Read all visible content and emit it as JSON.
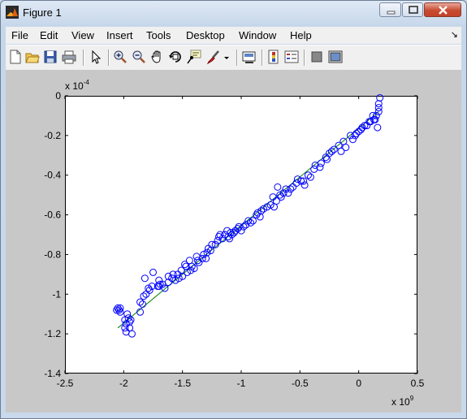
{
  "window": {
    "title": "Figure 1",
    "controls": [
      "minimize-icon",
      "maximize-icon",
      "close-icon"
    ]
  },
  "menu": [
    "File",
    "Edit",
    "View",
    "Insert",
    "Tools",
    "Desktop",
    "Window",
    "Help"
  ],
  "toolbar": [
    "new-figure-icon",
    "open-file-icon",
    "save-icon",
    "print-icon",
    "edit-plot-icon",
    "zoom-in-icon",
    "zoom-out-icon",
    "pan-icon",
    "rotate-3d-icon",
    "data-cursor-icon",
    "brush-icon",
    "brush-dropdown-icon",
    "link-plot-icon",
    "insert-colorbar-icon",
    "insert-legend-icon",
    "hide-plot-tools-icon",
    "show-plot-tools-icon"
  ],
  "chart_data": {
    "type": "scatter",
    "title": "",
    "xlabel": "",
    "ylabel": "",
    "x_exponent_label": "x 10",
    "x_exponent_power": "9",
    "y_exponent_label": "x 10",
    "y_exponent_power": "-4",
    "xlim": [
      -2.5,
      0.5
    ],
    "ylim": [
      -1.4,
      0
    ],
    "xticks": [
      "-2.5",
      "-2",
      "-1.5",
      "-1",
      "-0.5",
      "0",
      "0.5"
    ],
    "yticks": [
      "-1.4",
      "-1.2",
      "-1",
      "-0.8",
      "-0.6",
      "-0.4",
      "-0.2",
      "0"
    ],
    "grid": false,
    "marker": "circle",
    "colors": {
      "marker": "#0000ff",
      "fit_line": "#008000"
    },
    "fit_line": {
      "x": [
        -2.05,
        0.17
      ],
      "y": [
        -1.17,
        -0.08
      ]
    },
    "points": [
      [
        -2.05,
        -1.07
      ],
      [
        -2.06,
        -1.08
      ],
      [
        -2.04,
        -1.08
      ],
      [
        -2.03,
        -1.09
      ],
      [
        -1.99,
        -1.13
      ],
      [
        -1.98,
        -1.15
      ],
      [
        -1.99,
        -1.17
      ],
      [
        -1.98,
        -1.19
      ],
      [
        -1.96,
        -1.12
      ],
      [
        -1.95,
        -1.14
      ],
      [
        -1.95,
        -1.17
      ],
      [
        -1.93,
        -1.2
      ],
      [
        -1.86,
        -1.09
      ],
      [
        -1.84,
        -1.05
      ],
      [
        -1.83,
        -1.01
      ],
      [
        -1.82,
        -0.92
      ],
      [
        -1.78,
        -0.98
      ],
      [
        -1.76,
        -0.96
      ],
      [
        -1.71,
        -0.96
      ],
      [
        -1.7,
        -0.93
      ],
      [
        -1.69,
        -0.95
      ],
      [
        -1.65,
        -0.97
      ],
      [
        -1.62,
        -0.94
      ],
      [
        -1.59,
        -0.92
      ],
      [
        -1.56,
        -0.93
      ],
      [
        -1.54,
        -0.9
      ],
      [
        -1.51,
        -0.88
      ],
      [
        -1.5,
        -0.91
      ],
      [
        -1.47,
        -0.86
      ],
      [
        -1.46,
        -0.89
      ],
      [
        -1.44,
        -0.83
      ],
      [
        -1.42,
        -0.86
      ],
      [
        -1.4,
        -0.87
      ],
      [
        -1.38,
        -0.81
      ],
      [
        -1.36,
        -0.84
      ],
      [
        -1.32,
        -0.8
      ],
      [
        -1.3,
        -0.82
      ],
      [
        -1.28,
        -0.77
      ],
      [
        -1.26,
        -0.78
      ],
      [
        -1.2,
        -0.73
      ],
      [
        -1.18,
        -0.7
      ],
      [
        -1.14,
        -0.7
      ],
      [
        -1.12,
        -0.68
      ],
      [
        -1.1,
        -0.72
      ],
      [
        -1.08,
        -0.7
      ],
      [
        -1.06,
        -0.69
      ],
      [
        -1.03,
        -0.67
      ],
      [
        -1.0,
        -0.68
      ],
      [
        -0.96,
        -0.65
      ],
      [
        -0.92,
        -0.64
      ],
      [
        -0.9,
        -0.63
      ],
      [
        -0.86,
        -0.59
      ],
      [
        -0.84,
        -0.61
      ],
      [
        -0.81,
        -0.57
      ],
      [
        -0.75,
        -0.55
      ],
      [
        -0.72,
        -0.56
      ],
      [
        -0.69,
        -0.46
      ],
      [
        -0.66,
        -0.51
      ],
      [
        -0.64,
        -0.49
      ],
      [
        -0.6,
        -0.49
      ],
      [
        -0.56,
        -0.46
      ],
      [
        -0.53,
        -0.44
      ],
      [
        -0.49,
        -0.43
      ],
      [
        -0.46,
        -0.45
      ],
      [
        -0.41,
        -0.41
      ],
      [
        -0.38,
        -0.37
      ],
      [
        -0.32,
        -0.34
      ],
      [
        -0.27,
        -0.32
      ],
      [
        -0.25,
        -0.29
      ],
      [
        -0.21,
        -0.27
      ],
      [
        -0.15,
        -0.28
      ],
      [
        -0.11,
        -0.26
      ],
      [
        -0.05,
        -0.22
      ],
      [
        -0.03,
        -0.2
      ],
      [
        0.0,
        -0.18
      ],
      [
        0.03,
        -0.16
      ],
      [
        0.07,
        -0.15
      ],
      [
        0.1,
        -0.13
      ],
      [
        0.13,
        -0.12
      ],
      [
        0.15,
        -0.1
      ],
      [
        0.17,
        -0.08
      ],
      [
        0.17,
        -0.04
      ],
      [
        0.18,
        -0.01
      ],
      [
        0.16,
        -0.16
      ],
      [
        -2.03,
        -1.07
      ],
      [
        -1.97,
        -1.1
      ],
      [
        -1.94,
        -1.13
      ],
      [
        -1.86,
        -1.04
      ],
      [
        -1.81,
        -1.0
      ],
      [
        -1.79,
        -0.97
      ],
      [
        -1.75,
        -0.89
      ],
      [
        -1.7,
        -0.96
      ],
      [
        -1.67,
        -0.95
      ],
      [
        -1.62,
        -0.91
      ],
      [
        -1.58,
        -0.9
      ],
      [
        -1.53,
        -0.92
      ],
      [
        -1.48,
        -0.85
      ],
      [
        -1.43,
        -0.88
      ],
      [
        -1.37,
        -0.83
      ],
      [
        -1.33,
        -0.82
      ],
      [
        -1.29,
        -0.79
      ],
      [
        -1.25,
        -0.75
      ],
      [
        -1.22,
        -0.75
      ],
      [
        -1.19,
        -0.71
      ],
      [
        -1.16,
        -0.72
      ],
      [
        -1.14,
        -0.7
      ],
      [
        -1.11,
        -0.71
      ],
      [
        -1.09,
        -0.69
      ],
      [
        -1.05,
        -0.68
      ],
      [
        -1.02,
        -0.66
      ],
      [
        -0.98,
        -0.66
      ],
      [
        -0.94,
        -0.63
      ],
      [
        -0.87,
        -0.6
      ],
      [
        -0.83,
        -0.58
      ],
      [
        -0.78,
        -0.56
      ],
      [
        -0.73,
        -0.51
      ],
      [
        -0.7,
        -0.53
      ],
      [
        -0.67,
        -0.5
      ],
      [
        -0.62,
        -0.47
      ],
      [
        -0.58,
        -0.47
      ],
      [
        -0.52,
        -0.42
      ],
      [
        -0.47,
        -0.43
      ],
      [
        -0.43,
        -0.4
      ],
      [
        -0.37,
        -0.35
      ],
      [
        -0.33,
        -0.36
      ],
      [
        -0.28,
        -0.31
      ],
      [
        -0.23,
        -0.28
      ],
      [
        -0.17,
        -0.25
      ],
      [
        -0.13,
        -0.23
      ],
      [
        -0.07,
        -0.2
      ],
      [
        -0.02,
        -0.19
      ],
      [
        0.02,
        -0.17
      ],
      [
        0.05,
        -0.15
      ],
      [
        0.09,
        -0.13
      ],
      [
        0.12,
        -0.1
      ],
      [
        0.14,
        -0.12
      ],
      [
        0.17,
        -0.06
      ]
    ]
  }
}
